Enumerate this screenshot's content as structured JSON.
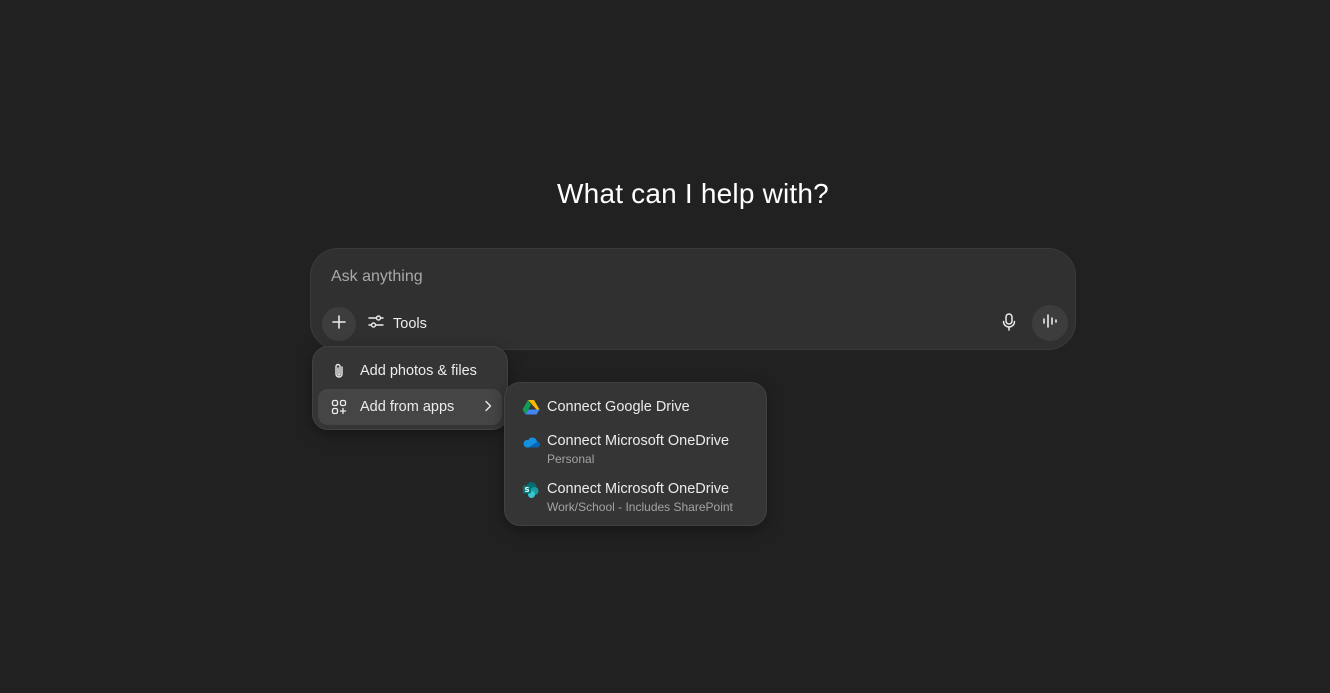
{
  "heading": "What can I help with?",
  "composer": {
    "placeholder": "Ask anything",
    "tools_label": "Tools"
  },
  "menu": {
    "items": [
      {
        "label": "Add photos & files",
        "icon": "paperclip-icon"
      },
      {
        "label": "Add from apps",
        "icon": "apps-icon",
        "has_submenu": true
      }
    ]
  },
  "submenu": {
    "items": [
      {
        "title": "Connect Google Drive",
        "subtitle": "",
        "icon": "google-drive-icon"
      },
      {
        "title": "Connect Microsoft OneDrive",
        "subtitle": "Personal",
        "icon": "onedrive-icon"
      },
      {
        "title": "Connect Microsoft OneDrive",
        "subtitle": "Work/School - Includes SharePoint",
        "icon": "sharepoint-icon"
      }
    ]
  },
  "colors": {
    "background": "#212121",
    "composer": "#303030",
    "menu": "#353535",
    "menu_active": "#454545"
  }
}
